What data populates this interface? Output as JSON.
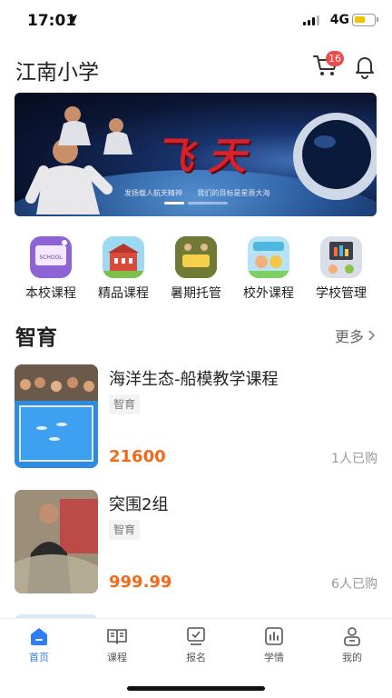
{
  "status_bar": {
    "time": "17:01",
    "network": "4G"
  },
  "header": {
    "title": "江南小学",
    "cart_count": "16"
  },
  "banner": {
    "title": "飞天",
    "subtitles": [
      "发扬载人航天精神",
      "我们的目标是星辰大海"
    ]
  },
  "quick_entries": [
    {
      "label": "本校课程",
      "icon": "school-course-icon"
    },
    {
      "label": "精品课程",
      "icon": "premium-course-icon"
    },
    {
      "label": "暑期托管",
      "icon": "summer-care-icon"
    },
    {
      "label": "校外课程",
      "icon": "offcampus-course-icon"
    },
    {
      "label": "学校管理",
      "icon": "school-management-icon"
    }
  ],
  "section": {
    "title": "智育",
    "more_label": "更多"
  },
  "courses": [
    {
      "title": "海洋生态-船模教学课程",
      "tag": "智育",
      "price": "21600",
      "sold": "1人已购"
    },
    {
      "title": "突围2组",
      "tag": "智育",
      "price": "999.99",
      "sold": "6人已购"
    }
  ],
  "tabs": [
    {
      "label": "首页",
      "icon": "home-icon",
      "active": true
    },
    {
      "label": "课程",
      "icon": "book-icon",
      "active": false
    },
    {
      "label": "报名",
      "icon": "signup-icon",
      "active": false
    },
    {
      "label": "学情",
      "icon": "chart-icon",
      "active": false
    },
    {
      "label": "我的",
      "icon": "user-icon",
      "active": false
    }
  ],
  "colors": {
    "accent": "#2f7cf6",
    "price": "#f2691a",
    "badge": "#f04b4b"
  }
}
